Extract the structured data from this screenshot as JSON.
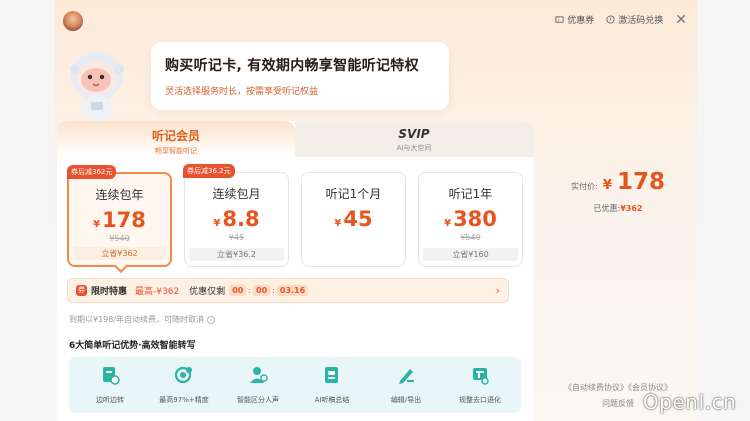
{
  "header": {
    "coupon_label": "优惠券",
    "activate_label": "激活码兑换"
  },
  "bubble": {
    "title": "购买听记卡, 有效期内畅享智能听记特权",
    "subtitle": "灵活选择服务时长，按需享受听记权益"
  },
  "tabs": [
    {
      "label": "听记会员",
      "sub": "畅享智能听记"
    },
    {
      "label": "SVIP",
      "sub": "AI与大空间"
    }
  ],
  "plans": [
    {
      "badge": "券后减362元",
      "name": "连续包年",
      "currency": "¥",
      "price": "178",
      "original": "¥540",
      "save": "立省¥362"
    },
    {
      "badge": "券后减36.2元",
      "name": "连续包月",
      "currency": "¥",
      "price": "8.8",
      "original": "¥45",
      "save": "立省¥36.2"
    },
    {
      "badge": "",
      "name": "听记1个月",
      "currency": "¥",
      "price": "45",
      "original": "",
      "save": ""
    },
    {
      "badge": "",
      "name": "听记1年",
      "currency": "¥",
      "price": "380",
      "original": "¥540",
      "save": "立省¥160"
    }
  ],
  "promo": {
    "icon_text": "券",
    "title": "限时特惠",
    "max": "最高-¥362",
    "countdown_label": "优惠仅剩",
    "hh": "00",
    "mm": "00",
    "ss": "03.16"
  },
  "renew_note": "到期以¥198/年自动续费，可随时取消",
  "features_title": "6大简单听记优势·高效智能转写",
  "features": [
    {
      "icon": "record-icon",
      "label": "边听边转"
    },
    {
      "icon": "accuracy-icon",
      "label": "最高97%+精度"
    },
    {
      "icon": "speaker-icon",
      "label": "智能区分人声"
    },
    {
      "icon": "ai-summary-icon",
      "label": "AI听稿总结"
    },
    {
      "icon": "edit-export-icon",
      "label": "编辑/导出"
    },
    {
      "icon": "cleanup-icon",
      "label": "规整去口语化"
    }
  ],
  "payment": {
    "label": "实付价:",
    "currency": "¥",
    "amount": "178",
    "discount_label": "已优惠:",
    "discount_value": "¥362"
  },
  "footer": {
    "agreements": "《自动续费协议》《会员协议》",
    "feedback": "问题反馈"
  },
  "watermark": "OpenI.cn",
  "colors": {
    "accent": "#e8541e",
    "badge": "#e9522f",
    "feature_bg": "#e8f6f7",
    "feature_icon": "#2ab3a6"
  }
}
